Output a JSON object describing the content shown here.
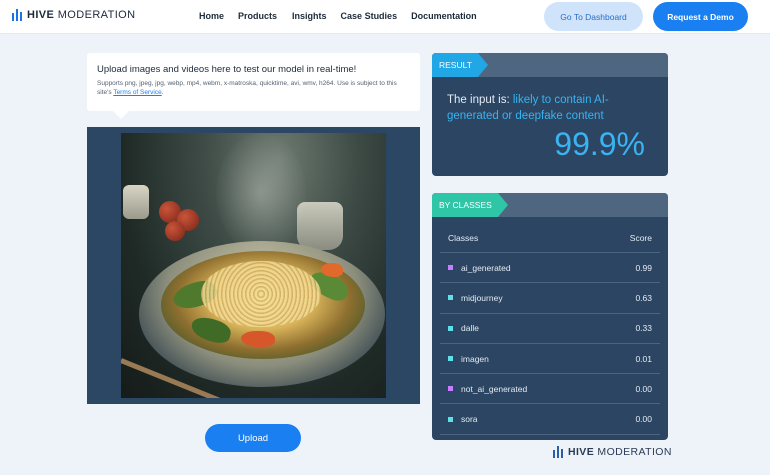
{
  "brand": {
    "bold": "HIVE",
    "rest": " MODERATION"
  },
  "nav": {
    "links": [
      "Home",
      "Products",
      "Insights",
      "Case Studies",
      "Documentation"
    ],
    "dashboard_label": "Go To Dashboard",
    "demo_label": "Request a Demo"
  },
  "upload": {
    "title": "Upload images and videos here to test our model in real-time!",
    "formats": "Supports png, jpeg, jpg, webp, mp4, webm, x-matroska, quicktime, avi, wmv, h264. Use is subject to this site's",
    "terms_link": "Terms of Service",
    "terms_suffix": ".",
    "button_label": "Upload"
  },
  "result": {
    "tag": "RESULT",
    "prefix": "The input is: ",
    "verdict": "likely to contain AI-generated or deepfake content",
    "score": "99.9%",
    "accent_color": "#39b3f2"
  },
  "classes": {
    "tag": "BY CLASSES",
    "header_class": "Classes",
    "header_score": "Score",
    "rows": [
      {
        "name": "ai_generated",
        "score": "0.99",
        "color": "#c77dff"
      },
      {
        "name": "midjourney",
        "score": "0.63",
        "color": "#5ee0e8"
      },
      {
        "name": "dalle",
        "score": "0.33",
        "color": "#5ee0e8"
      },
      {
        "name": "imagen",
        "score": "0.01",
        "color": "#5ee0e8"
      },
      {
        "name": "not_ai_generated",
        "score": "0.00",
        "color": "#c77dff"
      },
      {
        "name": "sora",
        "score": "0.00",
        "color": "#5ee0e8"
      }
    ]
  },
  "footer_brand": {
    "bold": "HIVE",
    "rest": " MODERATION"
  }
}
